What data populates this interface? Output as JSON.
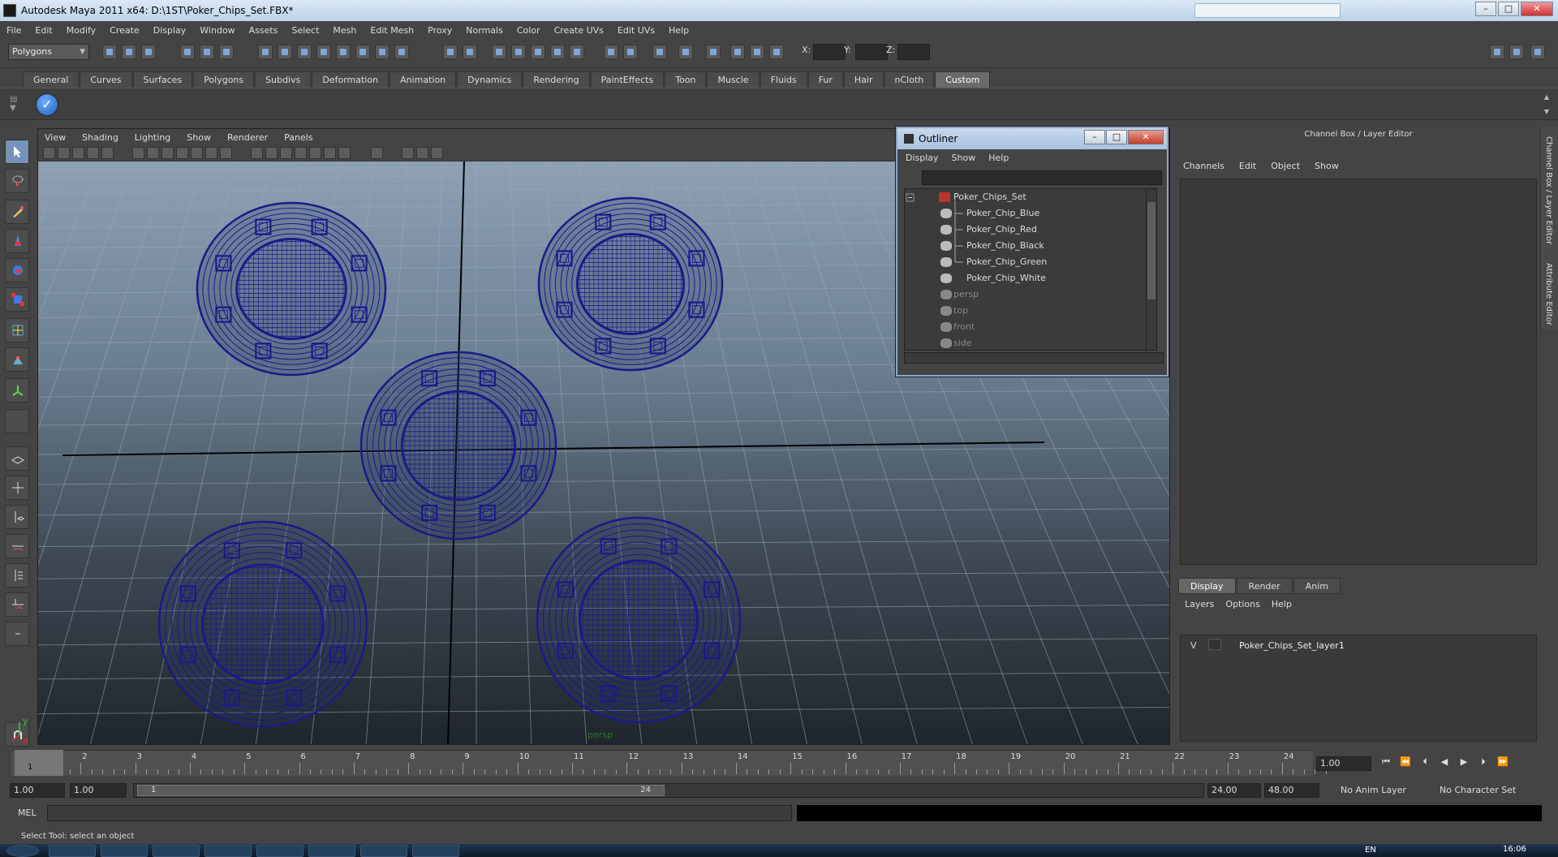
{
  "window": {
    "title": "Autodesk Maya 2011 x64: D:\\1ST\\Poker_Chips_Set.FBX*",
    "minimize": "–",
    "maximize": "□",
    "close": "✕"
  },
  "menubar": [
    "File",
    "Edit",
    "Modify",
    "Create",
    "Display",
    "Window",
    "Assets",
    "Select",
    "Mesh",
    "Edit Mesh",
    "Proxy",
    "Normals",
    "Color",
    "Create UVs",
    "Edit UVs",
    "Help"
  ],
  "statusline": {
    "mode": "Polygons",
    "x_label": "X:",
    "y_label": "Y:",
    "z_label": "Z:"
  },
  "shelf": {
    "tabs": [
      "General",
      "Curves",
      "Surfaces",
      "Polygons",
      "Subdivs",
      "Deformation",
      "Animation",
      "Dynamics",
      "Rendering",
      "PaintEffects",
      "Toon",
      "Muscle",
      "Fluids",
      "Fur",
      "Hair",
      "nCloth",
      "Custom"
    ],
    "active_tab": "Custom"
  },
  "viewport": {
    "menu": [
      "View",
      "Shading",
      "Lighting",
      "Show",
      "Renderer",
      "Panels"
    ],
    "camera": "persp",
    "axis_x": "x",
    "axis_y": "y",
    "wire_color": "#1a1a8a"
  },
  "outliner": {
    "title": "Outliner",
    "menu": [
      "Display",
      "Show",
      "Help"
    ],
    "items": [
      {
        "label": "Poker_Chips_Set",
        "dim": false
      },
      {
        "label": "Poker_Chip_Blue",
        "dim": false
      },
      {
        "label": "Poker_Chip_Red",
        "dim": false
      },
      {
        "label": "Poker_Chip_Black",
        "dim": false
      },
      {
        "label": "Poker_Chip_Green",
        "dim": false
      },
      {
        "label": "Poker_Chip_White",
        "dim": false
      },
      {
        "label": "persp",
        "dim": true
      },
      {
        "label": "top",
        "dim": true
      },
      {
        "label": "front",
        "dim": true
      },
      {
        "label": "side",
        "dim": true
      }
    ]
  },
  "channelbox": {
    "title": "Channel Box / Layer Editor",
    "menu": [
      "Channels",
      "Edit",
      "Object",
      "Show"
    ],
    "side_tab_1": "Channel Box / Layer Editor",
    "side_tab_2": "Attribute Editor"
  },
  "layereditor": {
    "tabs": [
      "Display",
      "Render",
      "Anim"
    ],
    "menu": [
      "Layers",
      "Options",
      "Help"
    ],
    "layer_visible": "V",
    "layer_name": "Poker_Chips_Set_layer1"
  },
  "timeline": {
    "ticks": [
      "1",
      "2",
      "3",
      "4",
      "5",
      "6",
      "7",
      "8",
      "9",
      "10",
      "11",
      "12",
      "13",
      "14",
      "15",
      "16",
      "17",
      "18",
      "19",
      "20",
      "21",
      "22",
      "23",
      "24"
    ],
    "current_frame": "1",
    "frame_field": "1.00",
    "playback": [
      "⏮",
      "⏪",
      "⏴",
      "◀",
      "▶",
      "⏵",
      "⏩"
    ]
  },
  "range": {
    "start": "1.00",
    "anim_start": "1.00",
    "range_start": "1",
    "range_end": "24",
    "anim_end": "24.00",
    "end": "48.00",
    "anim_layer": "No Anim Layer",
    "char_set": "No Character Set"
  },
  "cmdline": {
    "label": "MEL",
    "help": "Select Tool: select an object"
  },
  "taskbar": {
    "lang": "EN",
    "clock": "16:06"
  }
}
